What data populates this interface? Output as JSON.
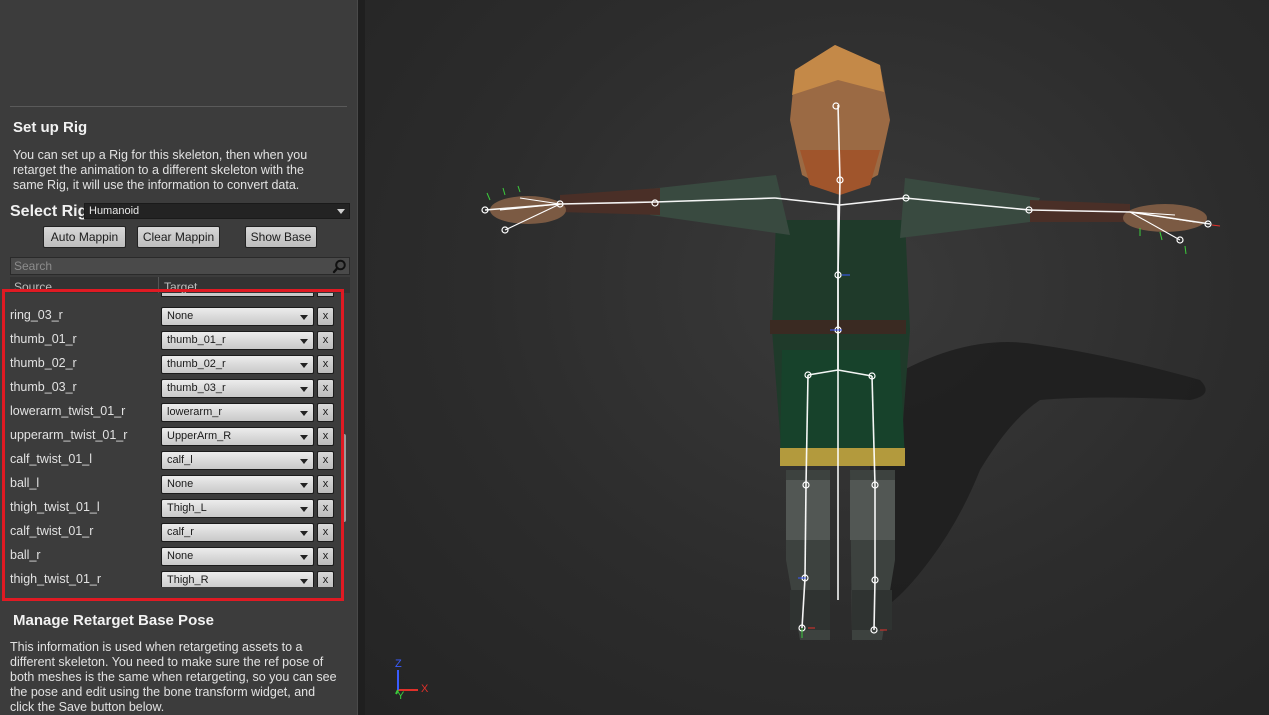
{
  "setup_rig": {
    "title": "Set up Rig",
    "description_lines": [
      "You can set up a Rig for this skeleton, then when you",
      "retarget the animation to a different skeleton with the",
      "same Rig, it will use the information to convert data."
    ],
    "select_rig_label": "Select Rig",
    "selected_rig": "Humanoid",
    "buttons": {
      "auto_mapping": "Auto  Mappin",
      "clear_mapping": "Clear Mappin",
      "show_base": "Show Base"
    },
    "search_placeholder": "Search",
    "columns": {
      "source": "Source",
      "target": "Target"
    },
    "mappings": [
      {
        "source": "ring_03_r",
        "target": "None",
        "clear": "x"
      },
      {
        "source": "thumb_01_r",
        "target": "thumb_01_r",
        "clear": "x"
      },
      {
        "source": "thumb_02_r",
        "target": "thumb_02_r",
        "clear": "x"
      },
      {
        "source": "thumb_03_r",
        "target": "thumb_03_r",
        "clear": "x"
      },
      {
        "source": "lowerarm_twist_01_r",
        "target": "lowerarm_r",
        "clear": "x"
      },
      {
        "source": "upperarm_twist_01_r",
        "target": "UpperArm_R",
        "clear": "x"
      },
      {
        "source": "calf_twist_01_l",
        "target": "calf_l",
        "clear": "x"
      },
      {
        "source": "ball_l",
        "target": "None",
        "clear": "x"
      },
      {
        "source": "thigh_twist_01_l",
        "target": "Thigh_L",
        "clear": "x"
      },
      {
        "source": "calf_twist_01_r",
        "target": "calf_r",
        "clear": "x"
      },
      {
        "source": "ball_r",
        "target": "None",
        "clear": "x"
      },
      {
        "source": "thigh_twist_01_r",
        "target": "Thigh_R",
        "clear": "x"
      }
    ]
  },
  "retarget_base_pose": {
    "title": "Manage Retarget Base Pose",
    "description_lines": [
      "This information is used when retargeting assets to a",
      "different skeleton. You need to make sure the ref pose of",
      "both meshes is the same when retargeting, so you can see",
      "the pose and edit using the bone transform widget, and",
      "click the Save button below."
    ]
  },
  "viewport": {
    "axis_x": "X",
    "axis_y": "Y",
    "axis_z": "Z",
    "colors": {
      "axis_x": "#e0302a",
      "axis_y": "#3ccc3c",
      "axis_z": "#3a5cff",
      "highlight": "#e01a23"
    }
  }
}
